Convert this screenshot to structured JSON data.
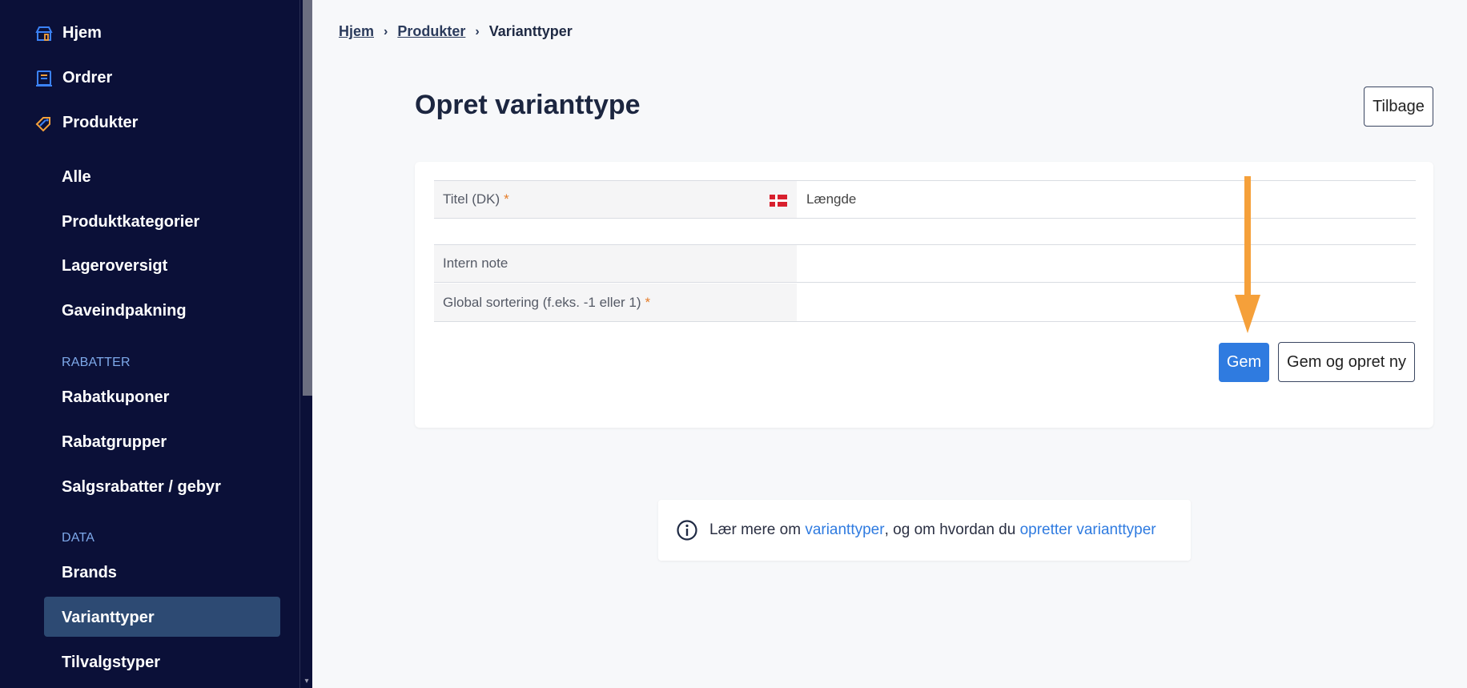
{
  "sidebar": {
    "top_items": [
      {
        "label": "Hjem",
        "icon": "store-icon"
      },
      {
        "label": "Ordrer",
        "icon": "orders-icon"
      },
      {
        "label": "Produkter",
        "icon": "tag-icon"
      }
    ],
    "product_items": [
      "Alle",
      "Produktkategorier",
      "Lageroversigt",
      "Gaveindpakning"
    ],
    "section_rabatter": "RABATTER",
    "rabat_items": [
      "Rabatkuponer",
      "Rabatgrupper",
      "Salgsrabatter / gebyr"
    ],
    "section_data": "DATA",
    "data_items": [
      "Brands",
      "Varianttyper",
      "Tilvalgstyper"
    ],
    "active_item": "Varianttyper"
  },
  "breadcrumb": {
    "items": [
      "Hjem",
      "Produkter",
      "Varianttyper"
    ]
  },
  "page": {
    "title": "Opret varianttype",
    "back_label": "Tilbage"
  },
  "form": {
    "title_label": "Titel (DK)",
    "title_required": "*",
    "title_value": "Længde",
    "note_label": "Intern note",
    "note_value": "",
    "sort_label": "Global sortering (f.eks. -1 eller 1)",
    "sort_required": "*",
    "sort_value": "",
    "save_label": "Gem",
    "save_new_label": "Gem og opret ny"
  },
  "info": {
    "text_before": "Lær mere om ",
    "link1": "varianttyper",
    "text_middle": ", og om hvordan du ",
    "link2": "opretter varianttyper"
  },
  "colors": {
    "sidebar_bg": "#0b1038",
    "active_bg": "#2d4a73",
    "accent": "#2f7be0",
    "arrow": "#f5a03a",
    "required": "#e57d2a"
  }
}
